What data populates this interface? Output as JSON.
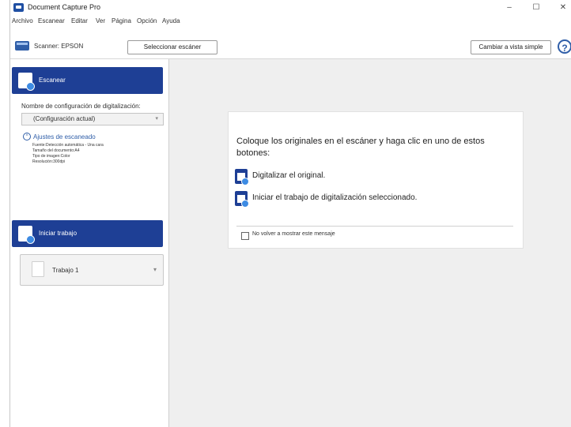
{
  "window": {
    "title": "Document Capture Pro",
    "controls": {
      "minimize": "–",
      "maximize": "☐",
      "close": "✕"
    }
  },
  "menu": [
    "Archivo",
    "Escanear",
    "Editar",
    "Ver",
    "Página",
    "Opción",
    "Ayuda"
  ],
  "toolbar": {
    "scanner_label": "Scanner: EPSON",
    "select_scanner_button": "Seleccionar escáner",
    "simple_view_button": "Cambiar a vista simple",
    "help_icon": "?"
  },
  "left_panel": {
    "scan_header": "Escanear",
    "config_name_label": "Nombre de configuración de digitalización:",
    "config_dropdown_value": "(Configuración actual)",
    "scan_settings_link": "Ajustes de escaneado",
    "scan_settings_details": [
      "Fuente:Detección automática - Una cara",
      "Tamaño del documento:A4",
      "Tipo de imagen:Color",
      "Resolución:300dpi"
    ],
    "job_header": "Iniciar trabajo",
    "job_dropdown_value": "Trabajo 1"
  },
  "dialog": {
    "instruction": "Coloque los originales en el escáner y haga clic en uno de estos botones:",
    "action_scan": "Digitalizar el original.",
    "action_job": "Iniciar el trabajo de digitalización seleccionado.",
    "dont_show_label": "No volver a mostrar este mensaje"
  },
  "colors": {
    "accent": "#1e3f95",
    "link": "#2f5ea8",
    "main_bg": "#efefef"
  },
  "icons": [
    "app-icon",
    "scanner-icon",
    "help-icon",
    "scan-icon",
    "job-start-icon",
    "document-icon",
    "chevron-down-icon",
    "collapse-icon"
  ]
}
